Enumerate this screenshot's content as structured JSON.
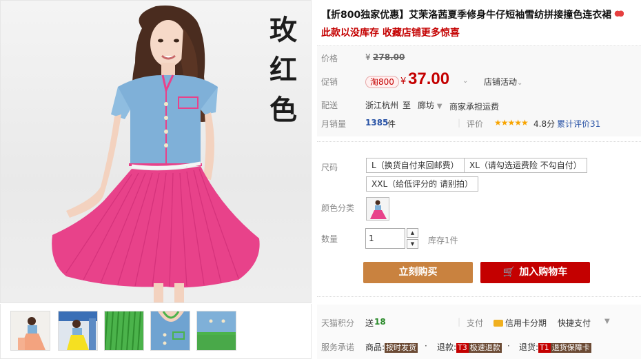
{
  "product": {
    "title_prefix": "【折800独家优惠】",
    "title": "艾茉洛茜夏季修身牛仔短袖雪纺拼接撞色连衣裙",
    "subtitle": "此款以没库存 收藏店铺更多惊喜",
    "color_caption": [
      "玫",
      "红",
      "色"
    ]
  },
  "price": {
    "label": "价格",
    "currency": "¥",
    "original": "278.00"
  },
  "promo": {
    "label": "促销",
    "badge": "淘800",
    "currency": "¥",
    "price": "37.00",
    "store_activity": "店铺活动"
  },
  "shipping": {
    "label": "配送",
    "from": "浙江杭州",
    "to_word": "至",
    "to": "廊坊",
    "fee": "商家承担运费"
  },
  "sales": {
    "label": "月销量",
    "count": "1385",
    "unit": "件",
    "rating_label": "评价",
    "stars": "★★★★★",
    "score": "4.8分",
    "cumulative": "累计评价31"
  },
  "sku": {
    "size_label": "尺码",
    "sizes": [
      "L（换货自付来回邮费）",
      "XL（请勾选运费险 不勾自付）",
      "XXL（给低评分的 请别拍）"
    ],
    "color_label": "颜色分类",
    "qty_label": "数量",
    "qty_value": "1",
    "up": "▲",
    "down": "▼",
    "stock": "库存1件"
  },
  "actions": {
    "buy_now": "立刻购买",
    "cart_icon": "🛒",
    "add_to_cart": "加入购物车"
  },
  "services": {
    "points_label": "天猫积分",
    "points_prefix": "送",
    "points_value": "18",
    "pay_label": "支付",
    "credit_card": "信用卡分期",
    "quick_pay": "快捷支付",
    "promise_label": "服务承诺",
    "goods_prefix": "商品:",
    "goods_tag": "按时发货",
    "refund_prefix": "退款:",
    "refund_tag_code": "T3",
    "refund_tag": "极速退款",
    "return_prefix": "退货:",
    "return_tag_code": "T1",
    "return_tag": "退货保障卡"
  },
  "colors": {
    "accent_red": "#c40000",
    "buy_button": "#c9823f",
    "dress_pink": "#e8428a",
    "denim_blue": "#7fb0d8"
  },
  "icons": [
    "heart-icon",
    "caret-down-icon",
    "cart-icon",
    "credit-card-icon",
    "spinner-up-icon",
    "spinner-down-icon"
  ]
}
